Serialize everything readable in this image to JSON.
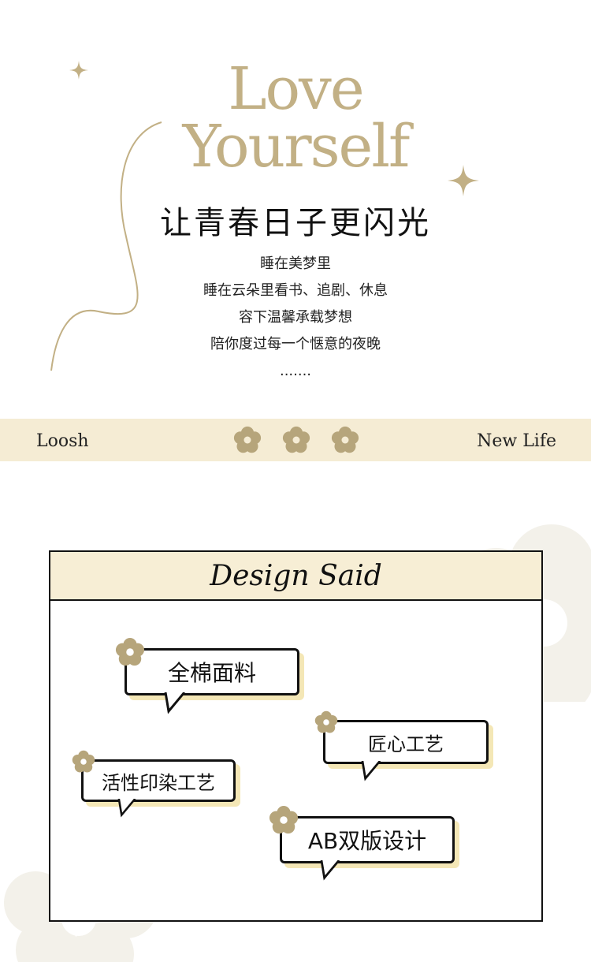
{
  "hero": {
    "title_line1": "Love",
    "title_line2": "Yourself",
    "subtitle": "让青春日子更闪光",
    "poem": [
      "睡在美梦里",
      "睡在云朵里看书、追剧、休息",
      "容下温馨承载梦想",
      "陪你度过每一个惬意的夜晚",
      "......."
    ]
  },
  "band": {
    "left_text": "Loosh",
    "right_text": "New Life"
  },
  "design": {
    "title": "Design Said",
    "bubbles": [
      "全棉面料",
      "匠心工艺",
      "活性印染工艺",
      "AB双版设计"
    ]
  },
  "colors": {
    "gold": "#c2b085",
    "cream": "#f5ecd4",
    "flower": "#b6a57b",
    "shadow": "#f4e7b6"
  }
}
